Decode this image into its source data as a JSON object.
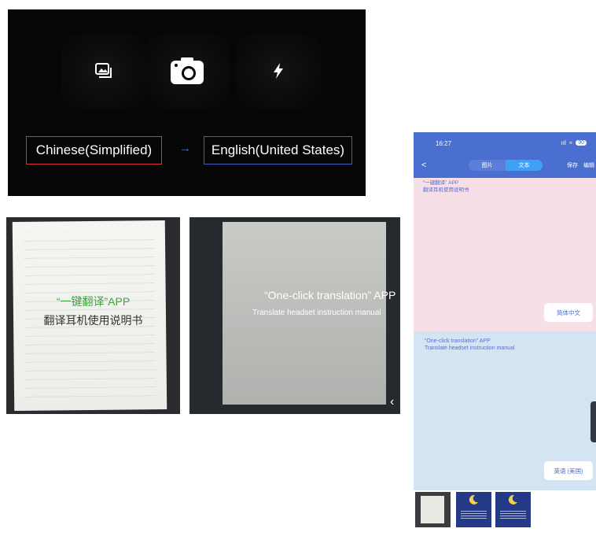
{
  "camera_panel": {
    "buttons": [
      {
        "id": "gallery",
        "icon": "gallery-icon"
      },
      {
        "id": "camera",
        "icon": "camera-icon"
      },
      {
        "id": "flash",
        "icon": "flash-icon"
      }
    ],
    "source_language": "Chinese(Simplified)",
    "target_language": "English(United States)",
    "arrow": "→",
    "source_border_color": "#d8333a",
    "target_border_color": "#3d5fbe"
  },
  "paper_photo": {
    "line1": "“一键翻译”APP",
    "line2": "翻译耳机使用说明书",
    "line1_color": "#3fa43f"
  },
  "scan_photo": {
    "line1": "“One-click translation” APP",
    "line2": "Translate headset instruction manual",
    "chevron": "‹"
  },
  "phone": {
    "status": {
      "time": "16:27",
      "signal": "ııl",
      "wifi": "≈",
      "battery": "90"
    },
    "back": "<",
    "tabs": [
      "图片",
      "文本"
    ],
    "active_tab": "文本",
    "actions": [
      "保存",
      "编辑"
    ],
    "source_text_line1": "“一键翻译” APP",
    "source_text_line2": "翻译耳机使用说明书",
    "source_language_pill": "简体中文",
    "translated_text_line1": "“One-click translation” APP",
    "translated_text_line2": "Translate headset instruction manual",
    "target_language_pill": "英语 (美国)",
    "header_color": "#4a6fd0"
  },
  "thumbnails": [
    "paper-thumbnail",
    "moon-card-thumbnail",
    "moon-card-thumbnail"
  ]
}
